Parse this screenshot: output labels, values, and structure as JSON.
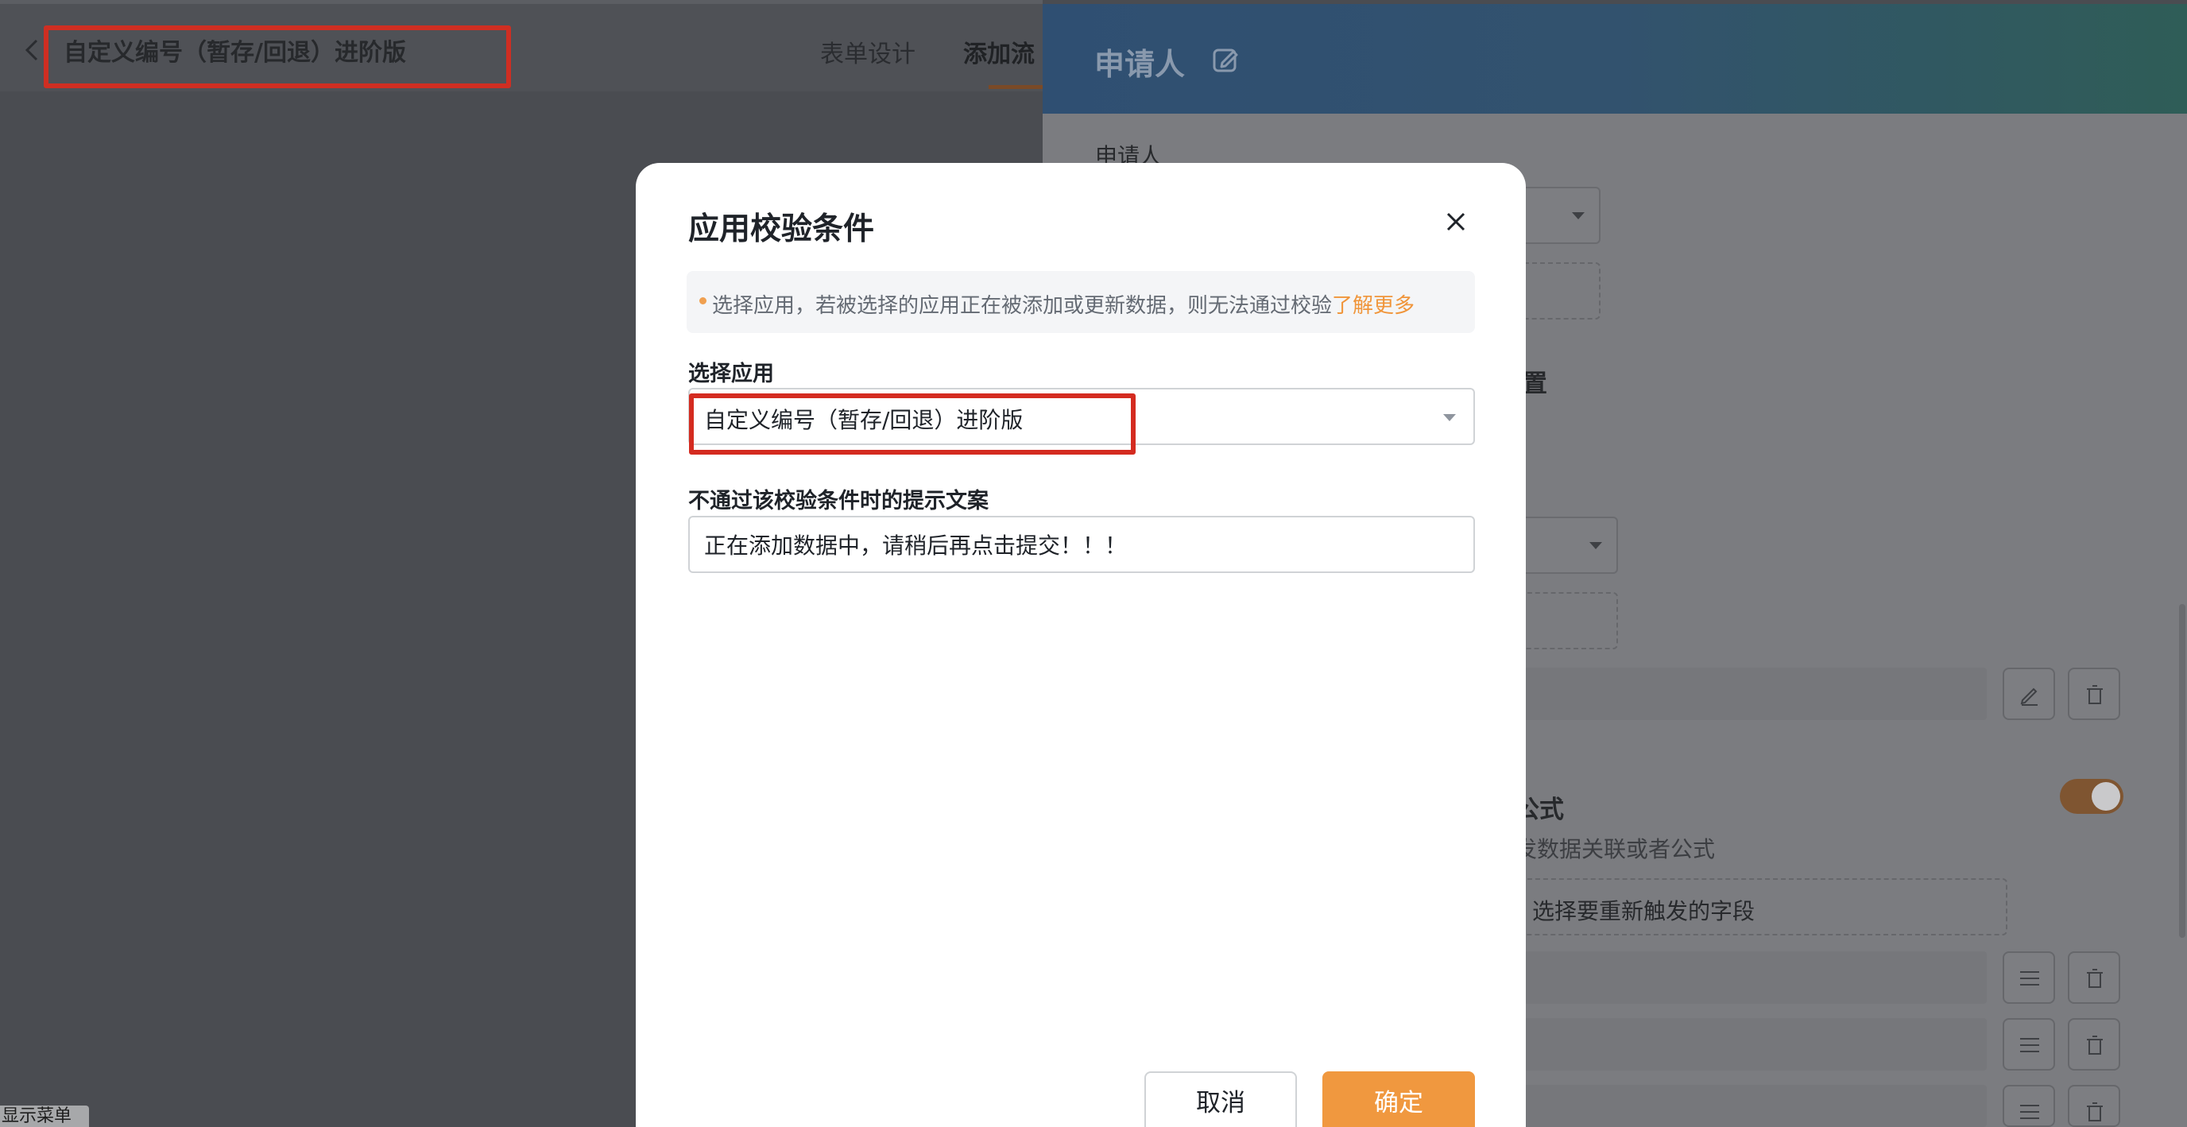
{
  "app": {
    "title": "自定义编号（暂存/回退）进阶版",
    "tabs": [
      {
        "label": "表单设计"
      },
      {
        "label": "添加流"
      }
    ]
  },
  "drawer": {
    "title": "申请人",
    "section_label": "申请人",
    "tab_partial": "置",
    "formula_title_partial": "公式",
    "formula_desc_partial": "发数据关联或者公式",
    "refire_field_partial": "选择要重新触发的字段",
    "toggle_on": true
  },
  "modal": {
    "title": "应用校验条件",
    "notice": {
      "text": "选择应用，若被选择的应用正在被添加或更新数据，则无法通过校验",
      "link": "了解更多"
    },
    "select_label": "选择应用",
    "select_value": "自定义编号（暂存/回退）进阶版",
    "message_label": "不通过该校验条件时的提示文案",
    "message_value": "正在添加数据中，请稍后再点击提交！！！",
    "cancel_label": "取消",
    "ok_label": "确定"
  },
  "bottom_tag": "显示菜单",
  "colors": {
    "accent": "#f0983f",
    "highlight_box": "#d42b20",
    "header_gradient_start": "#2f4f72",
    "header_gradient_end": "#2f5d57"
  },
  "icons": {
    "back": "chevron-left-icon",
    "edit": "edit-icon",
    "close": "close-icon",
    "pencil": "pencil-icon",
    "delete": "trash-icon",
    "drag": "drag-handle-icon"
  }
}
